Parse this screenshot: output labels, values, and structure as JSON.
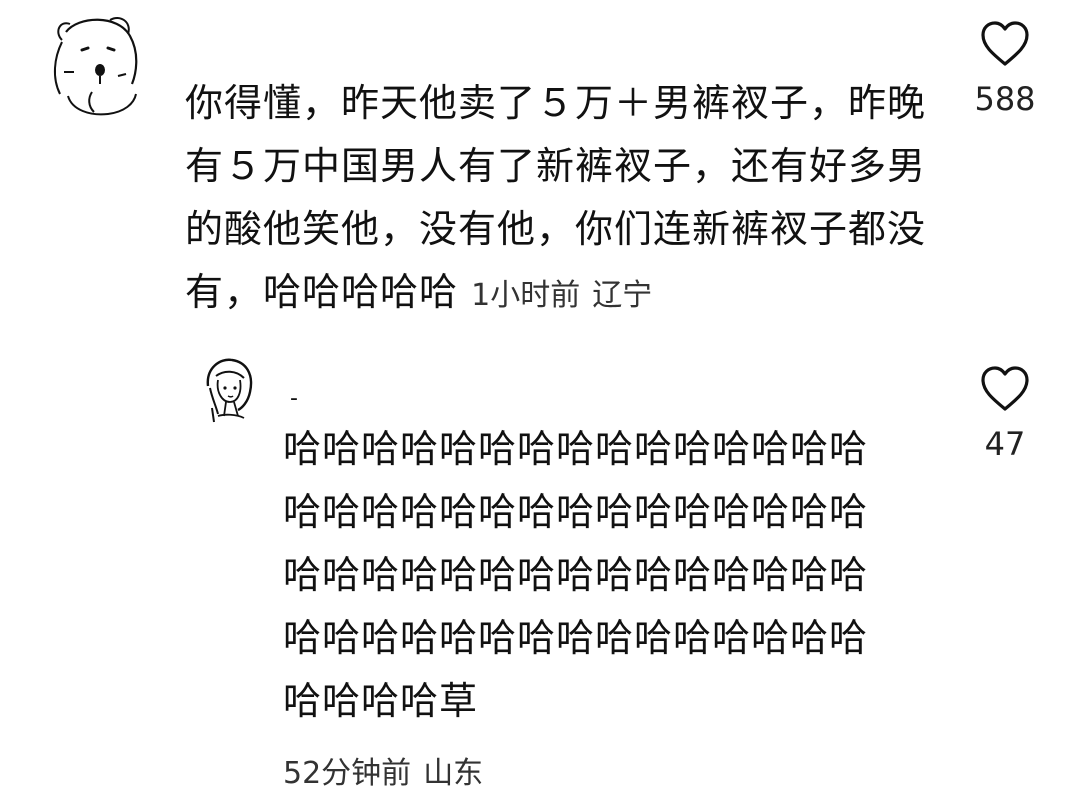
{
  "comments": [
    {
      "avatar_icon": "bear-avatar-icon",
      "text": "你得懂，昨天他卖了５万＋男裤衩子，昨晚有５万中国男人有了新裤衩子，还有好多男的酸他笑他，没有他，你们连新裤衩子都没有，哈哈哈哈哈",
      "time": "1小时前",
      "location": "辽宁",
      "likes": "588",
      "like_icon": "heart-outline-icon"
    },
    {
      "avatar_icon": "girl-avatar-icon",
      "username": "-",
      "text": "哈哈哈哈哈哈哈哈哈哈哈哈哈哈哈哈哈哈哈哈哈哈哈哈哈哈哈哈哈哈哈哈哈哈哈哈哈哈哈哈哈哈哈哈哈哈哈哈哈哈哈哈哈哈哈哈哈哈哈哈哈哈哈哈草",
      "time": "52分钟前",
      "location": "山东",
      "likes": "47",
      "like_icon": "heart-outline-icon"
    }
  ]
}
